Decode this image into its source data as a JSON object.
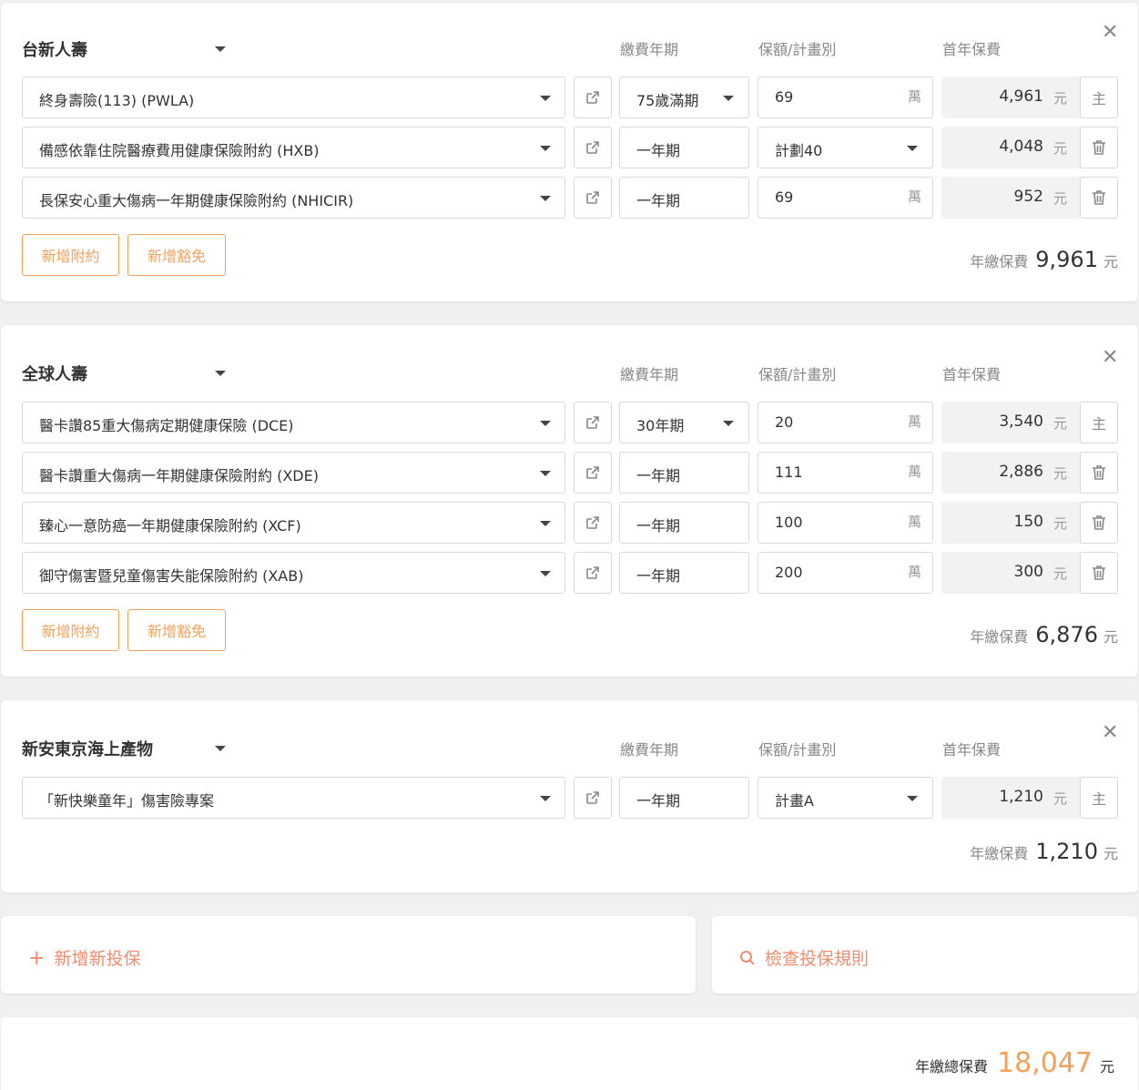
{
  "labels": {
    "pay_period": "繳費年期",
    "amount_plan": "保額/計畫別",
    "first_year_premium": "首年保費",
    "add_rider": "新增附約",
    "add_waiver": "新增豁免",
    "annual_premium": "年繳保費",
    "yuan": "元",
    "wan": "萬",
    "main_badge": "主"
  },
  "cards": [
    {
      "company": "台新人壽",
      "annual_total": "9,961",
      "rows": [
        {
          "product": "終身壽險(113) (PWLA)",
          "period": "75歲滿期",
          "period_dropdown": true,
          "amount": "69",
          "amount_unit": true,
          "amount_dropdown": false,
          "premium": "4,961",
          "action": "主"
        },
        {
          "product": "備感依靠住院醫療費用健康保險附約 (HXB)",
          "period": "一年期",
          "period_dropdown": false,
          "amount": "計劃40",
          "amount_unit": false,
          "amount_dropdown": true,
          "premium": "4,048",
          "action": "trash"
        },
        {
          "product": "長保安心重大傷病一年期健康保險附約 (NHICIR)",
          "period": "一年期",
          "period_dropdown": false,
          "amount": "69",
          "amount_unit": true,
          "amount_dropdown": false,
          "premium": "952",
          "action": "trash"
        }
      ]
    },
    {
      "company": "全球人壽",
      "annual_total": "6,876",
      "rows": [
        {
          "product": "醫卡讚85重大傷病定期健康保險 (DCE)",
          "period": "30年期",
          "period_dropdown": true,
          "amount": "20",
          "amount_unit": true,
          "amount_dropdown": false,
          "premium": "3,540",
          "action": "主"
        },
        {
          "product": "醫卡讚重大傷病一年期健康保險附約 (XDE)",
          "period": "一年期",
          "period_dropdown": false,
          "amount": "111",
          "amount_unit": true,
          "amount_dropdown": false,
          "premium": "2,886",
          "action": "trash"
        },
        {
          "product": "臻心一意防癌一年期健康保險附約 (XCF)",
          "period": "一年期",
          "period_dropdown": false,
          "amount": "100",
          "amount_unit": true,
          "amount_dropdown": false,
          "premium": "150",
          "action": "trash"
        },
        {
          "product": "御守傷害暨兒童傷害失能保險附約 (XAB)",
          "period": "一年期",
          "period_dropdown": false,
          "amount": "200",
          "amount_unit": true,
          "amount_dropdown": false,
          "premium": "300",
          "action": "trash"
        }
      ]
    },
    {
      "company": "新安東京海上產物",
      "annual_total": "1,210",
      "rows": [
        {
          "product": "「新快樂童年」傷害險專案",
          "period": "一年期",
          "period_dropdown": false,
          "amount": "計畫A",
          "amount_unit": false,
          "amount_dropdown": true,
          "premium": "1,210",
          "action": "主"
        }
      ]
    }
  ],
  "actions": {
    "add_new": "新增新投保",
    "check_rules": "檢查投保規則"
  },
  "total": {
    "label": "年繳總保費",
    "value": "18,047",
    "unit": "元"
  },
  "colors": {
    "accent": "#f5a05a",
    "accent_text": "#f08c70",
    "total_value": "#f5a05a"
  }
}
